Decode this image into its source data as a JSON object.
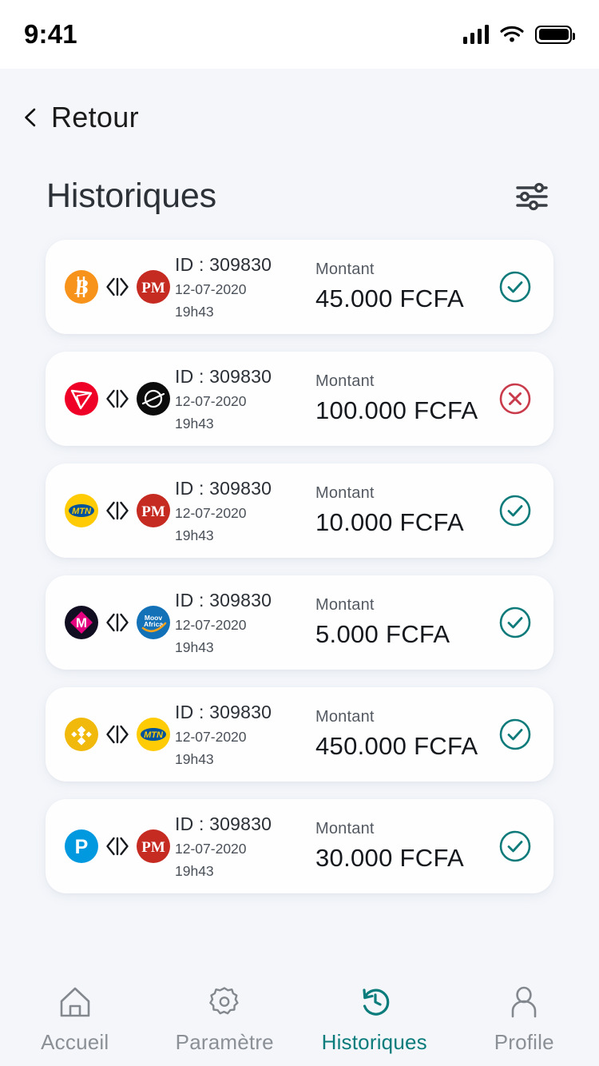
{
  "status_bar": {
    "time": "9:41",
    "signal_icon": "cellular-signal-icon",
    "wifi_icon": "wifi-icon",
    "battery_icon": "battery-full-icon"
  },
  "nav": {
    "back_label": "Retour",
    "back_icon": "chevron-left-icon"
  },
  "header": {
    "title": "Historiques",
    "filter_icon": "sliders-filter-icon"
  },
  "labels": {
    "amount_label": "Montant",
    "currency": "FCFA"
  },
  "colors": {
    "background": "#f4f6fa",
    "card": "#fefeff",
    "accent": "#0b7c7c",
    "success": "#0e7a7a",
    "error": "#c93b4b",
    "title": "#2c3138"
  },
  "transactions": [
    {
      "from_icon": "bitcoin-logo",
      "to_icon": "perfectmoney-logo",
      "id": "ID : 309830",
      "date": "12-07-2020",
      "time": "19h43",
      "amount_label": "Montant",
      "amount": "45.000 FCFA",
      "status": "success",
      "status_icon": "check-circle-icon"
    },
    {
      "from_icon": "tron-logo",
      "to_icon": "stellar-logo",
      "id": "ID : 309830",
      "date": "12-07-2020",
      "time": "19h43",
      "amount_label": "Montant",
      "amount": "100.000 FCFA",
      "status": "failed",
      "status_icon": "x-circle-icon"
    },
    {
      "from_icon": "mtn-logo",
      "to_icon": "perfectmoney-logo",
      "id": "ID : 309830",
      "date": "12-07-2020",
      "time": "19h43",
      "amount_label": "Montant",
      "amount": "10.000 FCFA",
      "status": "success",
      "status_icon": "check-circle-icon"
    },
    {
      "from_icon": "monero-m-logo",
      "to_icon": "moov-africa-logo",
      "id": "ID : 309830",
      "date": "12-07-2020",
      "time": "19h43",
      "amount_label": "Montant",
      "amount": "5.000 FCFA",
      "status": "success",
      "status_icon": "check-circle-icon"
    },
    {
      "from_icon": "binance-logo",
      "to_icon": "mtn-logo",
      "id": "ID : 309830",
      "date": "12-07-2020",
      "time": "19h43",
      "amount_label": "Montant",
      "amount": "450.000 FCFA",
      "status": "success",
      "status_icon": "check-circle-icon"
    },
    {
      "from_icon": "paypal-logo",
      "to_icon": "perfectmoney-logo",
      "id": "ID : 309830",
      "date": "12-07-2020",
      "time": "19h43",
      "amount_label": "Montant",
      "amount": "30.000 FCFA",
      "status": "success",
      "status_icon": "check-circle-icon"
    }
  ],
  "tabbar": {
    "items": [
      {
        "label": "Accueil",
        "icon": "home-icon",
        "active": false
      },
      {
        "label": "Paramètre",
        "icon": "gear-icon",
        "active": false
      },
      {
        "label": "Historiques",
        "icon": "history-clock-icon",
        "active": true
      },
      {
        "label": "Profile",
        "icon": "person-icon",
        "active": false
      }
    ]
  }
}
